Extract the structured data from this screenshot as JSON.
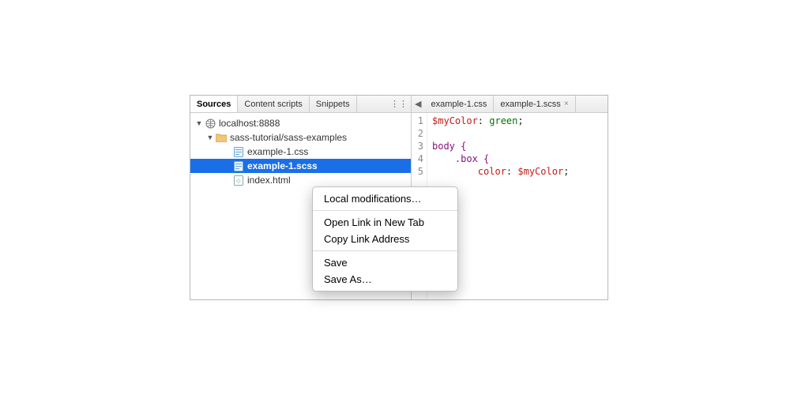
{
  "sidebar": {
    "tabs": {
      "sources": "Sources",
      "content_scripts": "Content scripts",
      "snippets": "Snippets"
    },
    "tree": {
      "host": "localhost:8888",
      "folder": "sass-tutorial/sass-examples",
      "files": {
        "css": "example-1.css",
        "scss": "example-1.scss",
        "html": "index.html"
      }
    }
  },
  "editor": {
    "tabs": {
      "css": "example-1.css",
      "scss": "example-1.scss"
    },
    "gutter": [
      "1",
      "2",
      "3",
      "4",
      "5"
    ],
    "code": {
      "l1a": "$myColor",
      "l1b": ": ",
      "l1c": "green",
      "l1d": ";",
      "l3": "body {",
      "l4": "    .box {",
      "l5a": "        ",
      "l5b": "color",
      "l5c": ": ",
      "l5d": "$myColor",
      "l5e": ";"
    }
  },
  "context_menu": {
    "local_mod": "Local modifications…",
    "open_tab": "Open Link in New Tab",
    "copy_link": "Copy Link Address",
    "save": "Save",
    "save_as": "Save As…"
  }
}
